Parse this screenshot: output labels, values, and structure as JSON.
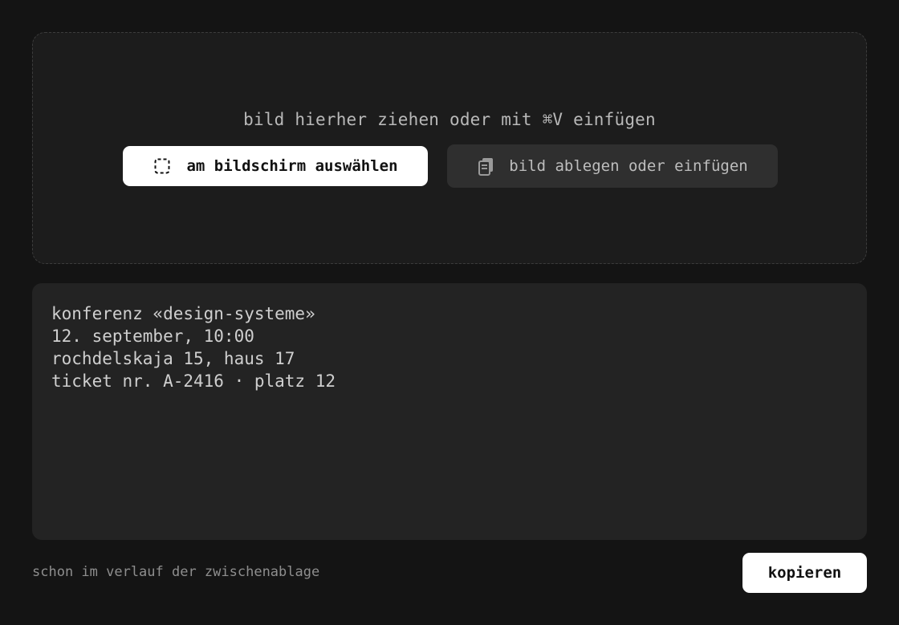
{
  "dropzone": {
    "hint": "bild hierher ziehen oder mit ⌘V einfügen",
    "select_button": {
      "label": "am bildschirm auswählen",
      "icon": "selection-icon"
    },
    "paste_button": {
      "label": "bild ablegen oder einfügen",
      "icon": "clipboard-icon"
    }
  },
  "result": {
    "lines": [
      "konferenz «design-systeme»",
      "12. september, 10:00",
      "rochdelskaja 15, haus 17",
      "ticket nr. A-2416 · platz 12"
    ]
  },
  "footer": {
    "status": "schon im verlauf der zwischenablage",
    "copy_label": "kopieren"
  },
  "colors": {
    "background": "#141414",
    "panel": "#1c1c1c",
    "result_panel": "#232323",
    "primary_button": "#ffffff",
    "secondary_button": "#2f2f2f"
  }
}
